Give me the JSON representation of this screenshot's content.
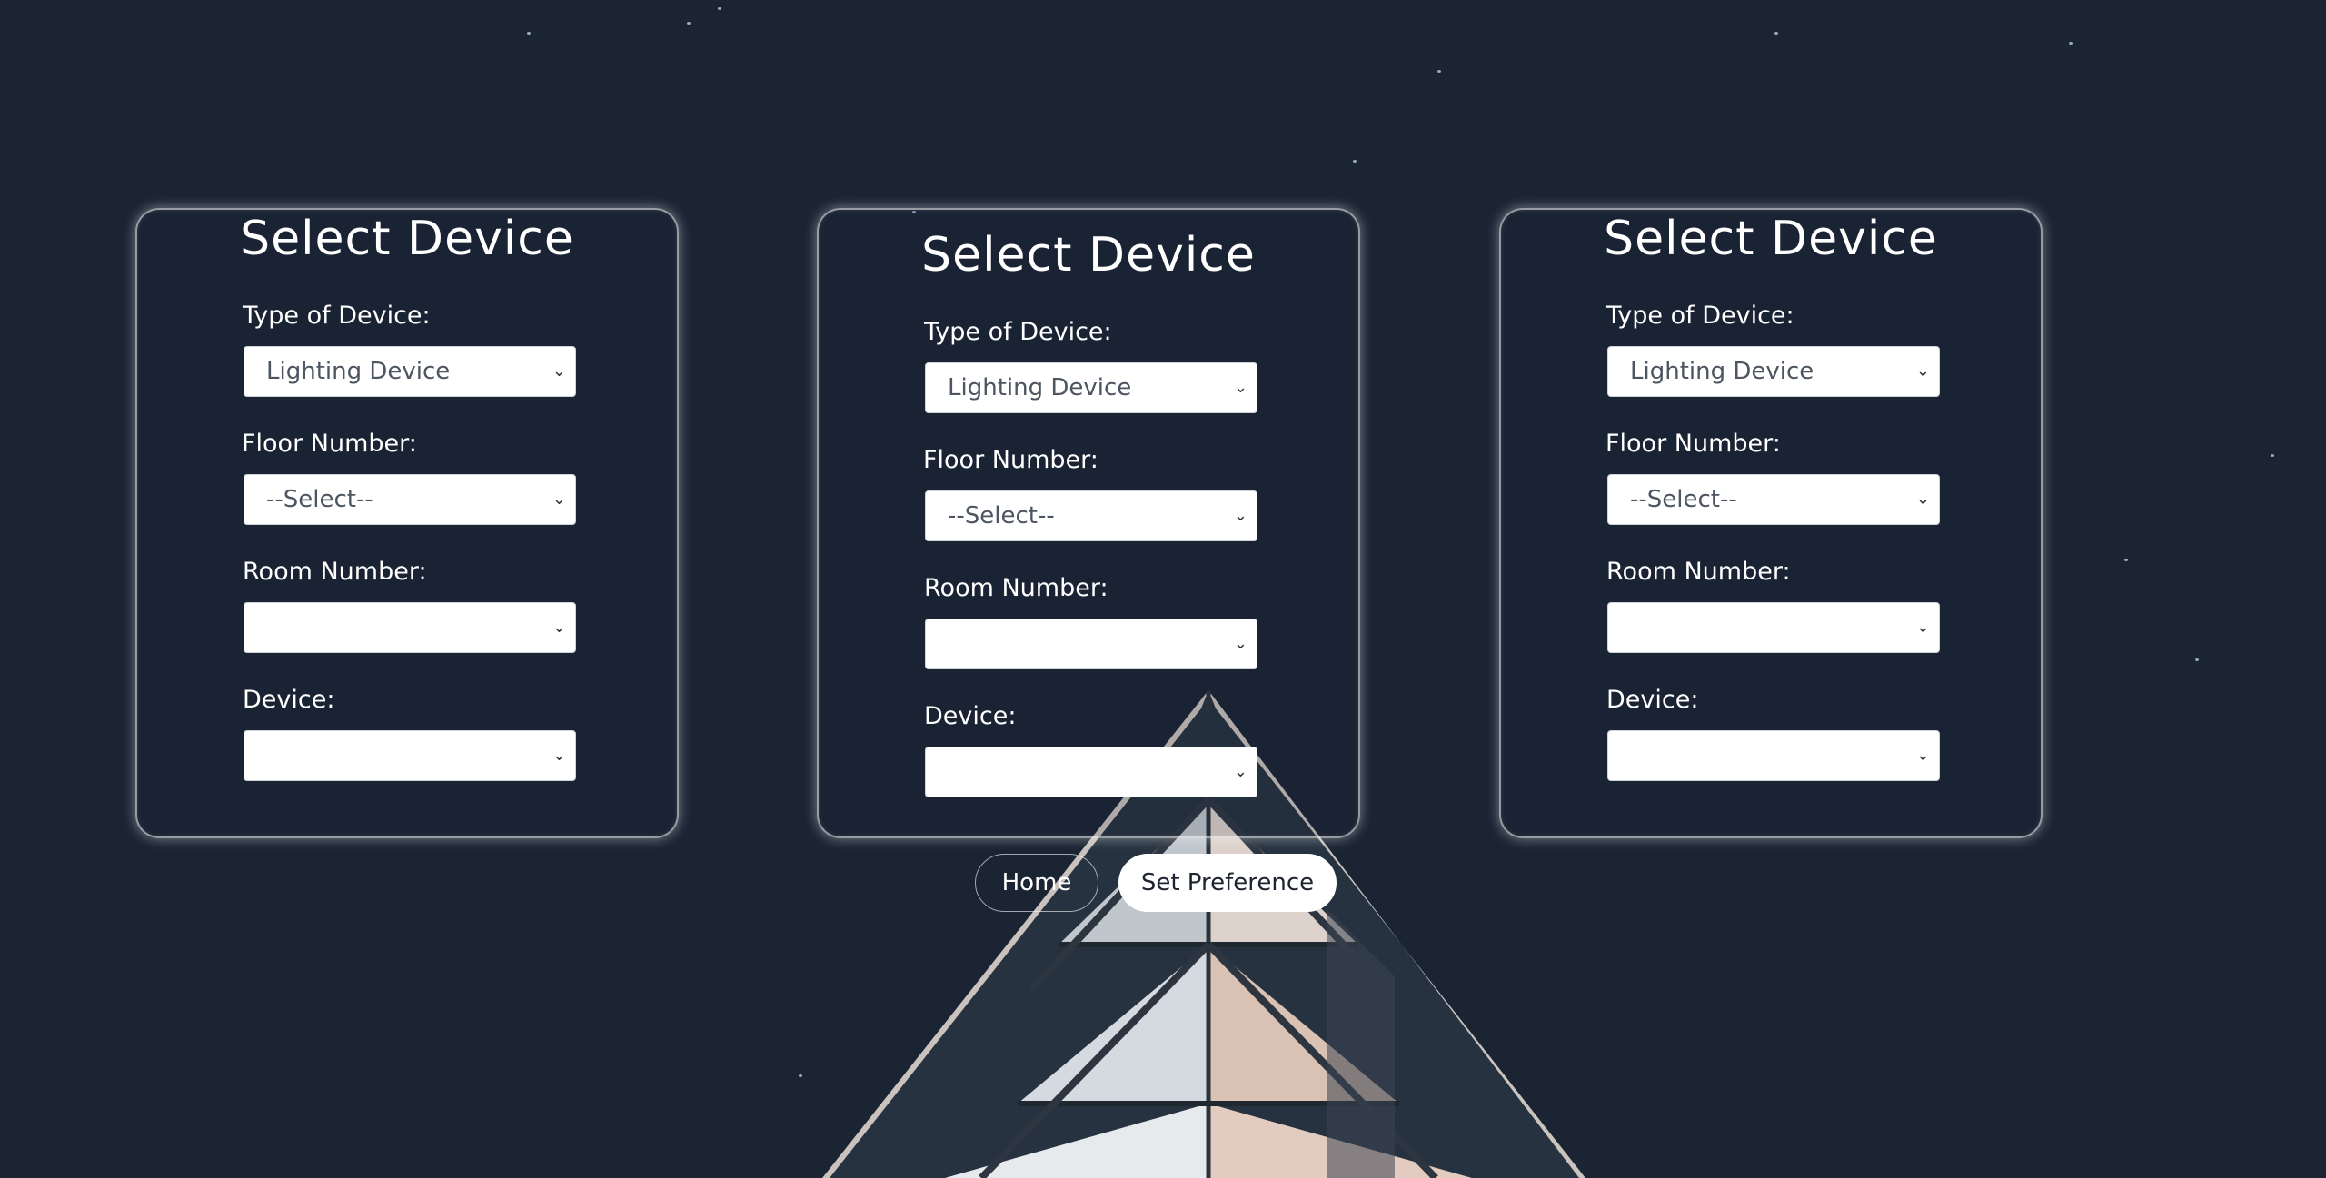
{
  "cards": [
    {
      "title": "Select Device",
      "type_label": "Type of Device:",
      "type_value": "Lighting Device",
      "floor_label": "Floor Number:",
      "floor_value": "--Select--",
      "room_label": "Room Number:",
      "room_value": "",
      "device_label": "Device:",
      "device_value": ""
    },
    {
      "title": "Select Device",
      "type_label": "Type of Device:",
      "type_value": "Lighting Device",
      "floor_label": "Floor Number:",
      "floor_value": "--Select--",
      "room_label": "Room Number:",
      "room_value": "",
      "device_label": "Device:",
      "device_value": ""
    },
    {
      "title": "Select Device",
      "type_label": "Type of Device:",
      "type_value": "Lighting Device",
      "floor_label": "Floor Number:",
      "floor_value": "--Select--",
      "room_label": "Room Number:",
      "room_value": "",
      "device_label": "Device:",
      "device_value": ""
    }
  ],
  "buttons": {
    "home_label": "Home",
    "preference_label": "Set Preference"
  },
  "icons": {
    "select_chevron": "chevron-down-icon"
  },
  "colors": {
    "background": "#1a2433",
    "card_border": "#ffffff",
    "select_background": "#ffffff",
    "select_text": "#4d5561",
    "button_primary_background": "#ffffff",
    "button_primary_text": "#1d2430"
  }
}
